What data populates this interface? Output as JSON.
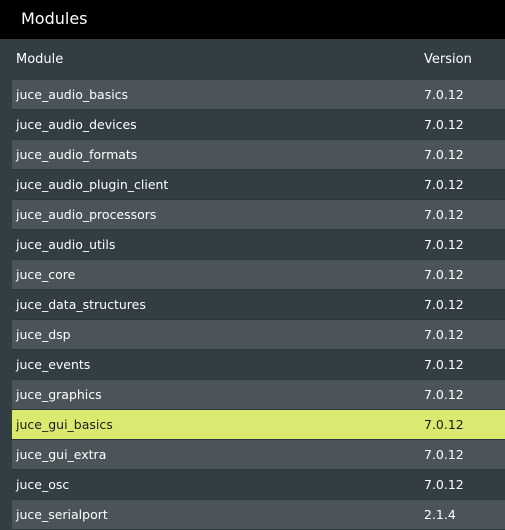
{
  "window": {
    "title": "Modules"
  },
  "table": {
    "columns": [
      "Module",
      "Version"
    ],
    "selected_index": 11,
    "rows": [
      {
        "module": "juce_audio_basics",
        "version": "7.0.12"
      },
      {
        "module": "juce_audio_devices",
        "version": "7.0.12"
      },
      {
        "module": "juce_audio_formats",
        "version": "7.0.12"
      },
      {
        "module": "juce_audio_plugin_client",
        "version": "7.0.12"
      },
      {
        "module": "juce_audio_processors",
        "version": "7.0.12"
      },
      {
        "module": "juce_audio_utils",
        "version": "7.0.12"
      },
      {
        "module": "juce_core",
        "version": "7.0.12"
      },
      {
        "module": "juce_data_structures",
        "version": "7.0.12"
      },
      {
        "module": "juce_dsp",
        "version": "7.0.12"
      },
      {
        "module": "juce_events",
        "version": "7.0.12"
      },
      {
        "module": "juce_graphics",
        "version": "7.0.12"
      },
      {
        "module": "juce_gui_basics",
        "version": "7.0.12"
      },
      {
        "module": "juce_gui_extra",
        "version": "7.0.12"
      },
      {
        "module": "juce_osc",
        "version": "7.0.12"
      },
      {
        "module": "juce_serialport",
        "version": "2.1.4"
      }
    ]
  },
  "colors": {
    "title_bar": "#000000",
    "background": "#323e44",
    "row_alt": "#4a5459",
    "selection": "#dbe970",
    "text": "#ffffff"
  }
}
